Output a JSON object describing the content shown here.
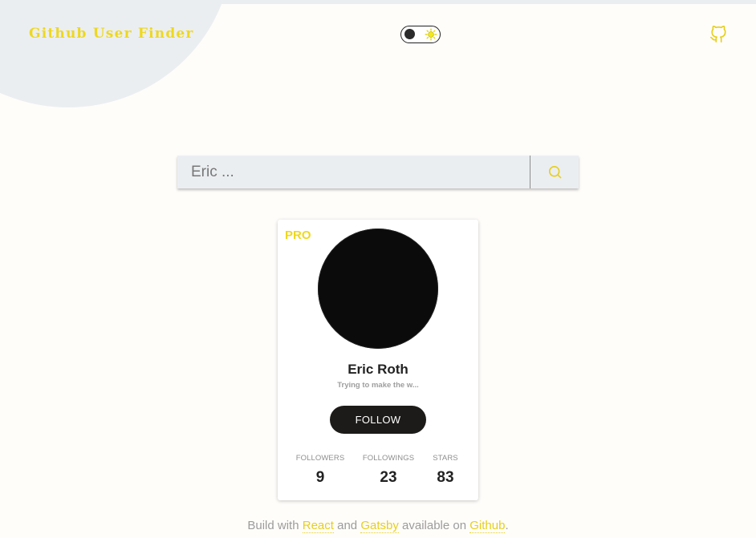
{
  "header": {
    "app_title": "Github User Finder",
    "theme_toggle": {
      "state": "light",
      "knob_icon": "dark-circle",
      "sun_icon": "sun-icon"
    },
    "github_icon": "github-icon"
  },
  "search": {
    "placeholder": "Eric ...",
    "value": "",
    "button_icon": "search-icon"
  },
  "card": {
    "badge": "PRO",
    "name": "Eric Roth",
    "bio": "Trying to make the w...",
    "follow_label": "FOLLOW",
    "stats": {
      "followers": {
        "label": "FOLLOWERS",
        "value": "9"
      },
      "followings": {
        "label": "FOLLOWINGS",
        "value": "23"
      },
      "stars": {
        "label": "STARS",
        "value": "83"
      }
    }
  },
  "footer": {
    "prefix": "Build with ",
    "react": "React",
    "and": " and ",
    "gatsby": "Gatsby",
    "available": " available on ",
    "github": "Github",
    "suffix": "."
  },
  "colors": {
    "accent": "#eed81f",
    "background": "#fffdfa",
    "surface": "#ebeef1",
    "dark": "#1d1b19"
  }
}
